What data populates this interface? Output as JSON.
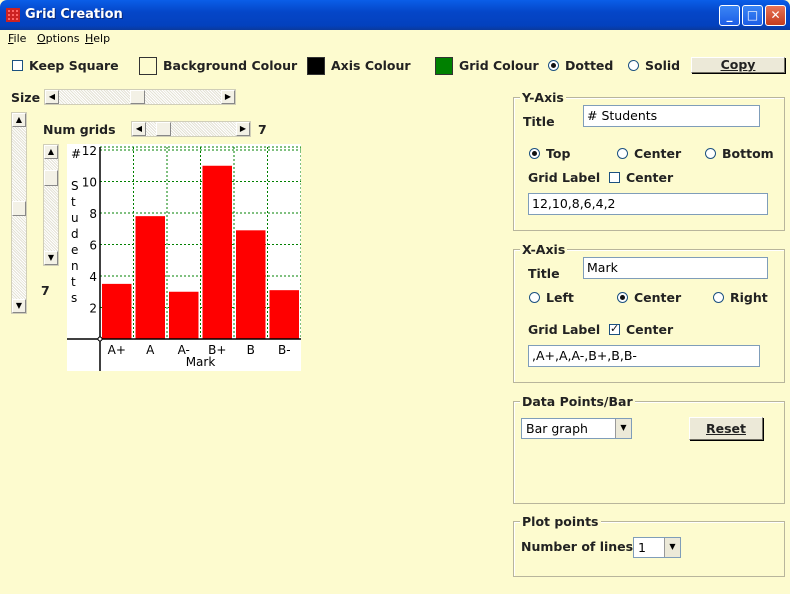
{
  "window": {
    "title": "Grid Creation",
    "minimize": "_",
    "maximize": "□",
    "close": "✕"
  },
  "menu": [
    {
      "label": "File"
    },
    {
      "label": "Options"
    },
    {
      "label": "Help"
    }
  ],
  "toolbar": {
    "keep_square": "Keep Square",
    "background_colour": "Background Colour",
    "axis_colour": "Axis Colour",
    "grid_colour": "Grid Colour",
    "dotted": "Dotted",
    "solid": "Solid",
    "copy": "Copy",
    "colors": {
      "background": "#ffffff",
      "axis": "#000000",
      "grid": "#008000"
    }
  },
  "left": {
    "size_label": "Size",
    "num_grids_label": "Num grids",
    "num_grids_value": "7",
    "vertical_value": "7"
  },
  "yaxis": {
    "legend": "Y-Axis",
    "title_label": "Title",
    "title_value": "# Students",
    "top": "Top",
    "center": "Center",
    "bottom": "Bottom",
    "grid_label": "Grid Label",
    "grid_center": "Center",
    "labels_value": "12,10,8,6,4,2"
  },
  "xaxis": {
    "legend": "X-Axis",
    "title_label": "Title",
    "title_value": "Mark",
    "left": "Left",
    "center": "Center",
    "right": "Right",
    "grid_label": "Grid Label",
    "grid_center": "Center",
    "labels_value": ",A+,A,A-,B+,B,B-"
  },
  "datapoints": {
    "legend": "Data Points/Bar",
    "type": "Bar graph",
    "reset": "Reset"
  },
  "plotpoints": {
    "legend": "Plot points",
    "lines_label": "Number of lines",
    "lines_value": "1"
  },
  "chart_data": {
    "type": "bar",
    "categories": [
      "A+",
      "A",
      "A-",
      "B+",
      "B",
      "B-"
    ],
    "values": [
      3.5,
      7.8,
      3,
      11,
      6.9,
      3.1
    ],
    "ylabel": "# Students",
    "xlabel": "Mark",
    "y_ticks": [
      "12",
      "10",
      "8",
      "6",
      "4",
      "2"
    ],
    "ylim": [
      0,
      12
    ],
    "grid": "dotted",
    "bar_color": "#ff0000",
    "grid_color": "#008000"
  }
}
